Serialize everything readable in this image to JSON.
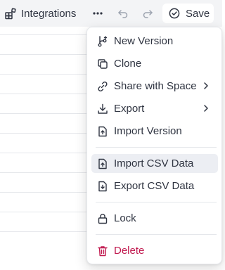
{
  "toolbar": {
    "integrations_label": "Integrations",
    "save_label": "Save",
    "icons": {
      "integrations": "integrations-blocks-icon",
      "more": "more-horizontal-icon",
      "undo": "undo-icon",
      "redo": "redo-icon",
      "save": "check-circle-icon"
    }
  },
  "menu": {
    "items": [
      {
        "label": "New Version",
        "icon": "branch-icon"
      },
      {
        "label": "Clone",
        "icon": "copy-icon"
      },
      {
        "label": "Share with Space",
        "icon": "link-icon",
        "submenu": true
      },
      {
        "label": "Export",
        "icon": "download-icon",
        "submenu": true
      },
      {
        "label": "Import Version",
        "icon": "file-upload-icon"
      },
      {
        "label": "Import CSV Data",
        "icon": "file-upload-icon",
        "highlighted": true
      },
      {
        "label": "Export CSV Data",
        "icon": "file-download-icon"
      },
      {
        "label": "Lock",
        "icon": "lock-icon"
      },
      {
        "label": "Delete",
        "icon": "trash-icon",
        "danger": true
      }
    ]
  },
  "colors": {
    "toolbar_bg": "#f3f4f6",
    "text": "#2f3441",
    "danger": "#c0174d",
    "highlight": "#eceef3"
  }
}
